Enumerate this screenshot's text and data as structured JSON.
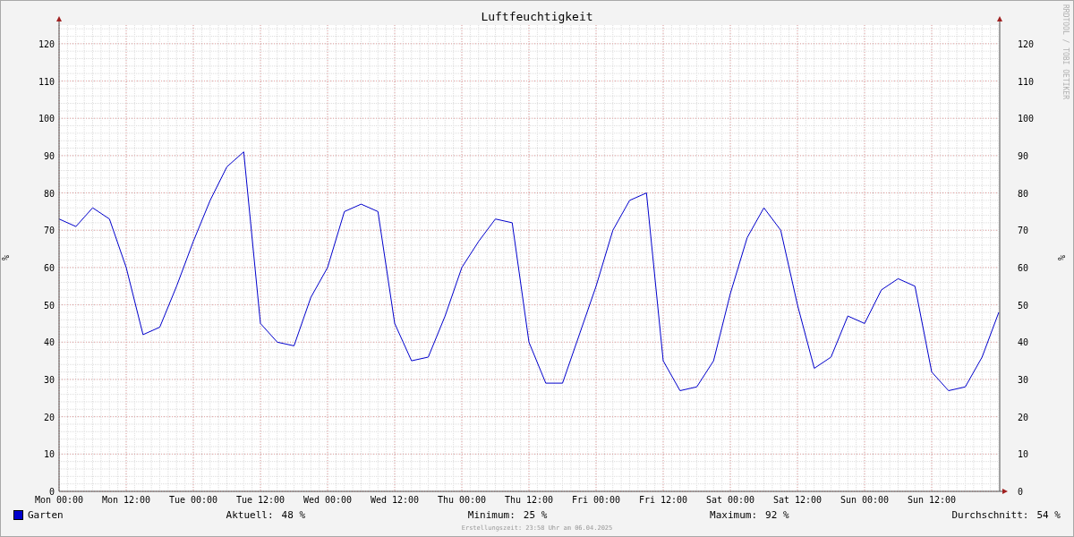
{
  "graph": {
    "credit": "RRDTOOL / TOBI OETIKER",
    "right_axis": {
      "label": "%",
      "ticks": [
        "120",
        "110",
        "100",
        "90",
        "80",
        "70",
        "60",
        "50",
        "40",
        "30",
        "20",
        "10",
        "0"
      ]
    },
    "chart_data": {
      "type": "line",
      "grid": true,
      "title": "Luftfeuchtigkeit",
      "ylabel": "%",
      "ylim": [
        0,
        125
      ],
      "yticks": [
        0,
        10,
        20,
        30,
        40,
        50,
        60,
        70,
        80,
        90,
        100,
        110,
        120
      ],
      "categories": [
        "Mon 00:00",
        null,
        null,
        null,
        "Mon 12:00",
        null,
        null,
        null,
        "Tue 00:00",
        null,
        null,
        null,
        "Tue 12:00",
        null,
        null,
        null,
        "Wed 00:00",
        null,
        null,
        null,
        "Wed 12:00",
        null,
        null,
        null,
        "Thu 00:00",
        null,
        null,
        null,
        "Thu 12:00",
        null,
        null,
        null,
        "Fri 00:00",
        null,
        null,
        null,
        "Fri 12:00",
        null,
        null,
        null,
        "Sat 00:00",
        null,
        null,
        null,
        "Sat 12:00",
        null,
        null,
        null,
        "Sun 00:00",
        null,
        null,
        null,
        "Sun 12:00",
        null,
        null,
        null,
        null
      ],
      "series": [
        {
          "name": "Garten",
          "color": "#0000cc",
          "values": [
            73,
            71,
            76,
            73,
            60,
            42,
            44,
            55,
            67,
            78,
            87,
            91,
            45,
            40,
            39,
            52,
            60,
            75,
            77,
            75,
            45,
            35,
            36,
            47,
            60,
            67,
            73,
            72,
            40,
            29,
            29,
            42,
            55,
            70,
            78,
            80,
            35,
            27,
            28,
            35,
            53,
            68,
            76,
            70,
            50,
            33,
            36,
            47,
            45,
            54,
            57,
            55,
            32,
            27,
            28,
            36,
            48
          ]
        }
      ]
    }
  },
  "legend": {
    "stats": [
      {
        "label": "Aktuell:",
        "value": "48 %"
      },
      {
        "label": "Minimum:",
        "value": "25 %"
      },
      {
        "label": "Maximum:",
        "value": "92 %"
      },
      {
        "label": "Durchschnitt:",
        "value": "54 %"
      }
    ]
  },
  "footer": "Erstellungszeit: 23:58 Uhr am 06.04.2025"
}
